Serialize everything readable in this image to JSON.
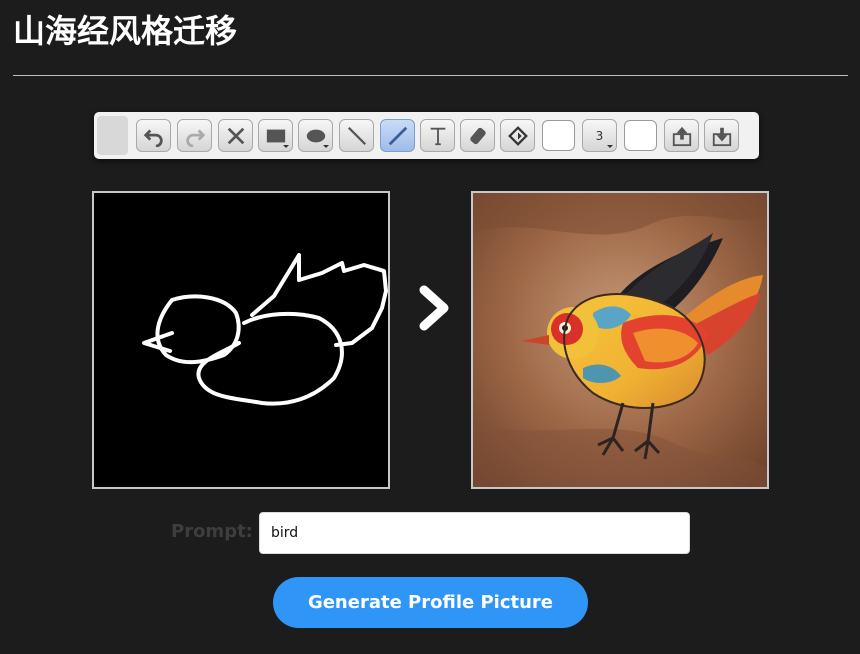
{
  "page": {
    "title": "山海经风格迁移"
  },
  "toolbar": {
    "tools": [
      {
        "icon": "undo-icon",
        "label": "undo"
      },
      {
        "icon": "redo-icon",
        "label": "redo"
      },
      {
        "icon": "clear-icon",
        "label": "clear"
      },
      {
        "icon": "rectangle-icon",
        "label": "rectangle"
      },
      {
        "icon": "ellipse-icon",
        "label": "ellipse"
      },
      {
        "icon": "line-icon",
        "label": "line"
      },
      {
        "icon": "pencil-icon",
        "label": "pencil",
        "active": true
      },
      {
        "icon": "text-icon",
        "label": "text"
      },
      {
        "icon": "eraser-icon",
        "label": "eraser"
      },
      {
        "icon": "fill-icon",
        "label": "fill"
      },
      {
        "icon": "stroke-color-swatch",
        "label": "stroke color"
      },
      {
        "icon": "brush-size-icon",
        "label": "brush size"
      },
      {
        "icon": "fill-color-swatch",
        "label": "fill color"
      },
      {
        "icon": "upload-icon",
        "label": "upload"
      },
      {
        "icon": "download-icon",
        "label": "download"
      }
    ],
    "brush_size": "3",
    "stroke_color": "#ffffff",
    "fill_color": "#ffffff"
  },
  "canvas": {
    "sketch_bg": "#000000",
    "sketch_stroke": "#ffffff"
  },
  "prompt": {
    "label": "Prompt:",
    "value": "bird",
    "placeholder": ""
  },
  "actions": {
    "generate_label": "Generate Profile Picture"
  },
  "colors": {
    "background": "#1c1c1c",
    "accent": "#2f96f7",
    "toolbar_bg": "#f1f1f1"
  }
}
